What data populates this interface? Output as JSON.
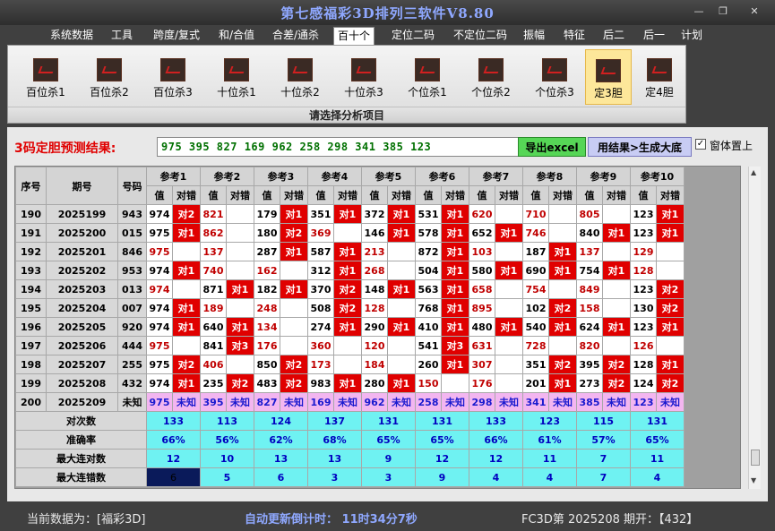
{
  "window": {
    "title": "第七感福彩3D排列三软件V8.80",
    "min": "—",
    "max": "❐",
    "close": "✕"
  },
  "menu": [
    "系统数据",
    "工具",
    "跨度/复式",
    "和/合值",
    "合差/通杀",
    "百十个",
    "定位二码",
    "不定位二码",
    "振幅",
    "特征",
    "后二",
    "后一",
    "计划"
  ],
  "menu_active": 5,
  "ribbon": {
    "buttons": [
      "百位杀1",
      "百位杀2",
      "百位杀3",
      "十位杀1",
      "十位杀2",
      "十位杀3",
      "个位杀1",
      "个位杀2",
      "个位杀3",
      "定3胆",
      "定4胆"
    ],
    "active": 9,
    "footer": "请选择分析项目"
  },
  "prediction": {
    "label": "3码定胆预测结果:",
    "value": "975 395 827 169 962 258 298 341 385 123",
    "export_label": "导出excel",
    "generate_label": "用结果>生成大底",
    "ontop_checked": "✓",
    "ontop_label": "窗体置上"
  },
  "table": {
    "headers": {
      "seq": "序号",
      "period": "期号",
      "code": "号码",
      "refs": [
        "参考1",
        "参考2",
        "参考3",
        "参考4",
        "参考5",
        "参考6",
        "参考7",
        "参考8",
        "参考9",
        "参考10"
      ],
      "val": "值",
      "hit": "对错"
    },
    "rows": [
      {
        "seq": "190",
        "period": "2025199",
        "code": "943",
        "cells": [
          [
            "974",
            "对2"
          ],
          [
            "821",
            ""
          ],
          [
            "179",
            "对1"
          ],
          [
            "351",
            "对1"
          ],
          [
            "372",
            "对1"
          ],
          [
            "531",
            "对1"
          ],
          [
            "620",
            ""
          ],
          [
            "710",
            ""
          ],
          [
            "805",
            ""
          ],
          [
            "123",
            "对1"
          ]
        ]
      },
      {
        "seq": "191",
        "period": "2025200",
        "code": "015",
        "cells": [
          [
            "975",
            "对1"
          ],
          [
            "862",
            ""
          ],
          [
            "180",
            "对2"
          ],
          [
            "369",
            ""
          ],
          [
            "146",
            "对1"
          ],
          [
            "578",
            "对1"
          ],
          [
            "652",
            "对1"
          ],
          [
            "746",
            ""
          ],
          [
            "840",
            "对1"
          ],
          [
            "123",
            "对1"
          ]
        ]
      },
      {
        "seq": "192",
        "period": "2025201",
        "code": "846",
        "cells": [
          [
            "975",
            ""
          ],
          [
            "137",
            ""
          ],
          [
            "287",
            "对1"
          ],
          [
            "587",
            "对1"
          ],
          [
            "213",
            ""
          ],
          [
            "872",
            "对1"
          ],
          [
            "103",
            ""
          ],
          [
            "187",
            "对1"
          ],
          [
            "137",
            ""
          ],
          [
            "129",
            ""
          ]
        ]
      },
      {
        "seq": "193",
        "period": "2025202",
        "code": "953",
        "cells": [
          [
            "974",
            "对1"
          ],
          [
            "740",
            ""
          ],
          [
            "162",
            ""
          ],
          [
            "312",
            "对1"
          ],
          [
            "268",
            ""
          ],
          [
            "504",
            "对1"
          ],
          [
            "580",
            "对1"
          ],
          [
            "690",
            "对1"
          ],
          [
            "754",
            "对1"
          ],
          [
            "128",
            ""
          ]
        ]
      },
      {
        "seq": "194",
        "period": "2025203",
        "code": "013",
        "cells": [
          [
            "974",
            ""
          ],
          [
            "871",
            "对1"
          ],
          [
            "182",
            "对1"
          ],
          [
            "370",
            "对2"
          ],
          [
            "148",
            "对1"
          ],
          [
            "563",
            "对1"
          ],
          [
            "658",
            ""
          ],
          [
            "754",
            ""
          ],
          [
            "849",
            ""
          ],
          [
            "123",
            "对2"
          ]
        ]
      },
      {
        "seq": "195",
        "period": "2025204",
        "code": "007",
        "cells": [
          [
            "974",
            "对1"
          ],
          [
            "189",
            ""
          ],
          [
            "248",
            ""
          ],
          [
            "508",
            "对2"
          ],
          [
            "128",
            ""
          ],
          [
            "768",
            "对1"
          ],
          [
            "895",
            ""
          ],
          [
            "102",
            "对2"
          ],
          [
            "158",
            ""
          ],
          [
            "130",
            "对2"
          ]
        ]
      },
      {
        "seq": "196",
        "period": "2025205",
        "code": "920",
        "cells": [
          [
            "974",
            "对1"
          ],
          [
            "640",
            "对1"
          ],
          [
            "134",
            ""
          ],
          [
            "274",
            "对1"
          ],
          [
            "290",
            "对1"
          ],
          [
            "410",
            "对1"
          ],
          [
            "480",
            "对1"
          ],
          [
            "540",
            "对1"
          ],
          [
            "624",
            "对1"
          ],
          [
            "123",
            "对1"
          ]
        ]
      },
      {
        "seq": "197",
        "period": "2025206",
        "code": "444",
        "cells": [
          [
            "975",
            ""
          ],
          [
            "841",
            "对3"
          ],
          [
            "176",
            ""
          ],
          [
            "360",
            ""
          ],
          [
            "120",
            ""
          ],
          [
            "541",
            "对3"
          ],
          [
            "631",
            ""
          ],
          [
            "728",
            ""
          ],
          [
            "820",
            ""
          ],
          [
            "126",
            ""
          ]
        ]
      },
      {
        "seq": "198",
        "period": "2025207",
        "code": "255",
        "cells": [
          [
            "975",
            "对2"
          ],
          [
            "406",
            ""
          ],
          [
            "850",
            "对2"
          ],
          [
            "173",
            ""
          ],
          [
            "184",
            ""
          ],
          [
            "260",
            "对1"
          ],
          [
            "307",
            ""
          ],
          [
            "351",
            "对2"
          ],
          [
            "395",
            "对2"
          ],
          [
            "128",
            "对1"
          ]
        ]
      },
      {
        "seq": "199",
        "period": "2025208",
        "code": "432",
        "cells": [
          [
            "974",
            "对1"
          ],
          [
            "235",
            "对2"
          ],
          [
            "483",
            "对2"
          ],
          [
            "983",
            "对1"
          ],
          [
            "280",
            "对1"
          ],
          [
            "150",
            ""
          ],
          [
            "176",
            ""
          ],
          [
            "201",
            "对1"
          ],
          [
            "273",
            "对2"
          ],
          [
            "124",
            "对2"
          ]
        ]
      }
    ],
    "pred_row": {
      "seq": "200",
      "period": "2025209",
      "code": "未知",
      "cells": [
        [
          "975",
          "未知"
        ],
        [
          "395",
          "未知"
        ],
        [
          "827",
          "未知"
        ],
        [
          "169",
          "未知"
        ],
        [
          "962",
          "未知"
        ],
        [
          "258",
          "未知"
        ],
        [
          "298",
          "未知"
        ],
        [
          "341",
          "未知"
        ],
        [
          "385",
          "未知"
        ],
        [
          "123",
          "未知"
        ]
      ]
    },
    "stats": [
      {
        "label": "对次数",
        "values": [
          "133",
          "113",
          "124",
          "137",
          "131",
          "131",
          "133",
          "123",
          "115",
          "131"
        ]
      },
      {
        "label": "准确率",
        "values": [
          "66%",
          "56%",
          "62%",
          "68%",
          "65%",
          "65%",
          "66%",
          "61%",
          "57%",
          "65%"
        ]
      },
      {
        "label": "最大连对数",
        "values": [
          "12",
          "10",
          "13",
          "13",
          "9",
          "12",
          "12",
          "11",
          "7",
          "11"
        ]
      },
      {
        "label": "最大连错数",
        "values": [
          "6",
          "5",
          "6",
          "3",
          "3",
          "9",
          "4",
          "4",
          "7",
          "4"
        ]
      }
    ]
  },
  "status": {
    "current": "当前数据为：[福彩3D]",
    "countdown": "自动更新倒计时：  11时34分7秒",
    "draw": "FC3D第 2025208 期开：【432】"
  },
  "colors": {
    "hit": "#e00000",
    "stat": "#6ff2f2",
    "pred": "#f3b6f0",
    "accent": "#8fa8ff"
  }
}
